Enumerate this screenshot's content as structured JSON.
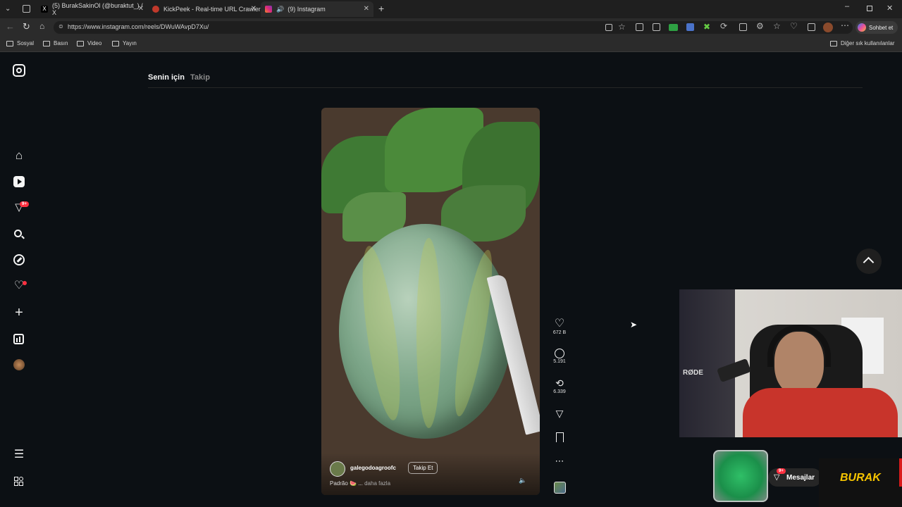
{
  "browser": {
    "tabs": [
      {
        "title": "(5) BurakSakinOl (@buraktut_) / X"
      },
      {
        "title": "KickPeek - Real-time URL Crawler"
      },
      {
        "title": "(9) Instagram"
      }
    ],
    "url": "https://www.instagram.com/reels/DWuWAvpD7Xu/",
    "copilot_label": "Sohbet et",
    "bookmarks": [
      "Sosyal",
      "Basın",
      "Video",
      "Yayın"
    ],
    "other_bookmarks": "Diğer sık kullanılanlar"
  },
  "feed_tabs": {
    "for_you": "Senin için",
    "following": "Takip"
  },
  "nav": {
    "notifications_badge": "9+"
  },
  "reel": {
    "username": "galegodoagroofc",
    "follow_label": "Takip Et",
    "caption": "Padrão 🍉 ...",
    "more_label": "daha fazla"
  },
  "actions": {
    "likes": "672 B",
    "comments": "5.191",
    "reposts": "6.339"
  },
  "overlay": {
    "messages_label": "Mesajlar",
    "messages_badge": "9+",
    "streamer_name": "BURAK",
    "mic_brand": "RØDE"
  }
}
